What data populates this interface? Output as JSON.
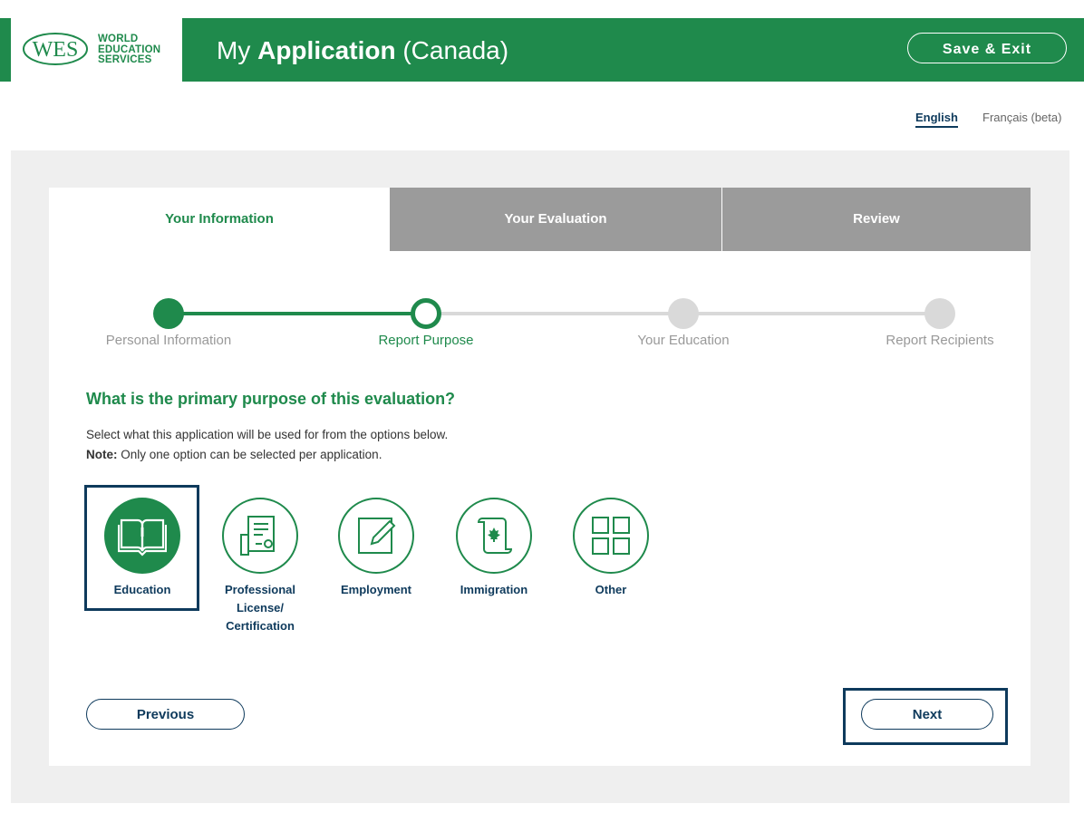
{
  "header": {
    "logo_mark": "WES",
    "logo_lines": [
      "WORLD",
      "EDUCATION",
      "SERVICES"
    ],
    "title_prefix": "My",
    "title_bold": "Application",
    "title_suffix": "(Canada)",
    "save_exit_label": "Save & Exit"
  },
  "language": {
    "active": "English",
    "other": "Français (beta)"
  },
  "tabs": [
    {
      "label": "Your Information",
      "state": "active"
    },
    {
      "label": "Your Evaluation",
      "state": "inactive"
    },
    {
      "label": "Review",
      "state": "inactive"
    }
  ],
  "stepper": [
    {
      "label": "Personal Information",
      "state": "complete"
    },
    {
      "label": "Report Purpose",
      "state": "current"
    },
    {
      "label": "Your Education",
      "state": "upcoming"
    },
    {
      "label": "Report Recipients",
      "state": "upcoming"
    }
  ],
  "question": {
    "title": "What is the primary purpose of this evaluation?",
    "instruction": "Select what this application will be used for from the options below.",
    "note_label": "Note:",
    "note_text": " Only one option can be selected per application."
  },
  "options": [
    {
      "label": "Education",
      "icon": "book-icon",
      "selected": true
    },
    {
      "label": "Professional License/ Certification",
      "label_lines": [
        "Professional",
        "License/",
        "Certification"
      ],
      "icon": "certificate-icon",
      "selected": false
    },
    {
      "label": "Employment",
      "icon": "edit-icon",
      "selected": false
    },
    {
      "label": "Immigration",
      "icon": "scroll-maple-leaf-icon",
      "selected": false
    },
    {
      "label": "Other",
      "icon": "grid-icon",
      "selected": false
    }
  ],
  "buttons": {
    "previous": "Previous",
    "next": "Next"
  },
  "colors": {
    "brand_green": "#1f8a4c",
    "navy": "#0e3a5c",
    "tab_inactive": "#9b9b9b"
  }
}
